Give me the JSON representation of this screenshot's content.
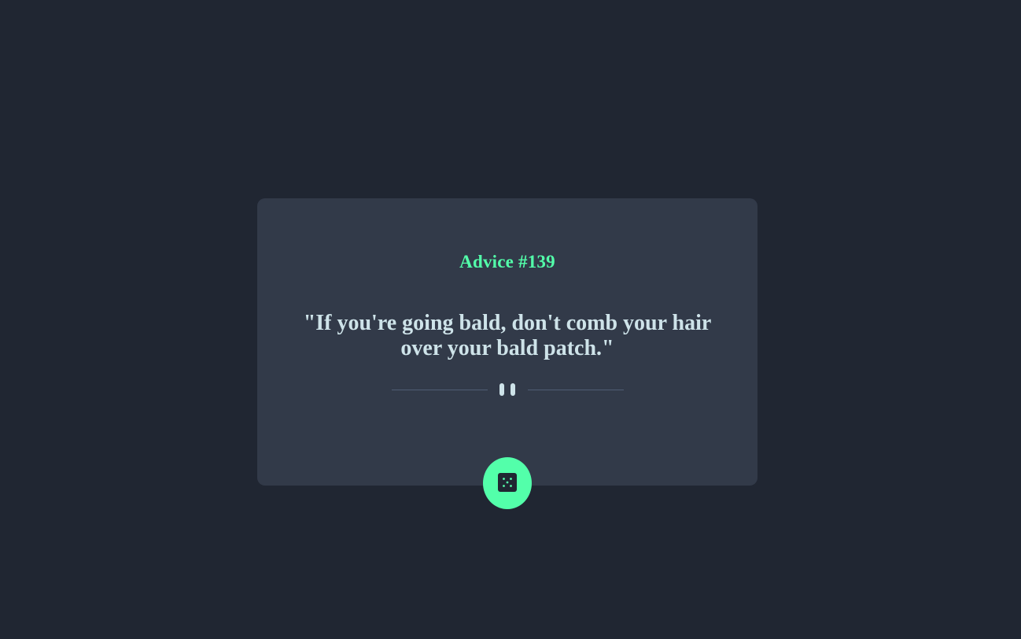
{
  "advice": {
    "id_label": "Advice #139",
    "text": "\"If you're going bald, don't comb your hair over your bald patch.\""
  },
  "divider": {
    "icon": "pause-icon"
  },
  "button": {
    "icon": "dice-icon"
  },
  "colors": {
    "background": "#202632",
    "card": "#323a49",
    "accent": "#53ffaa",
    "text": "#cee3e9",
    "divider": "#4f5d74"
  }
}
